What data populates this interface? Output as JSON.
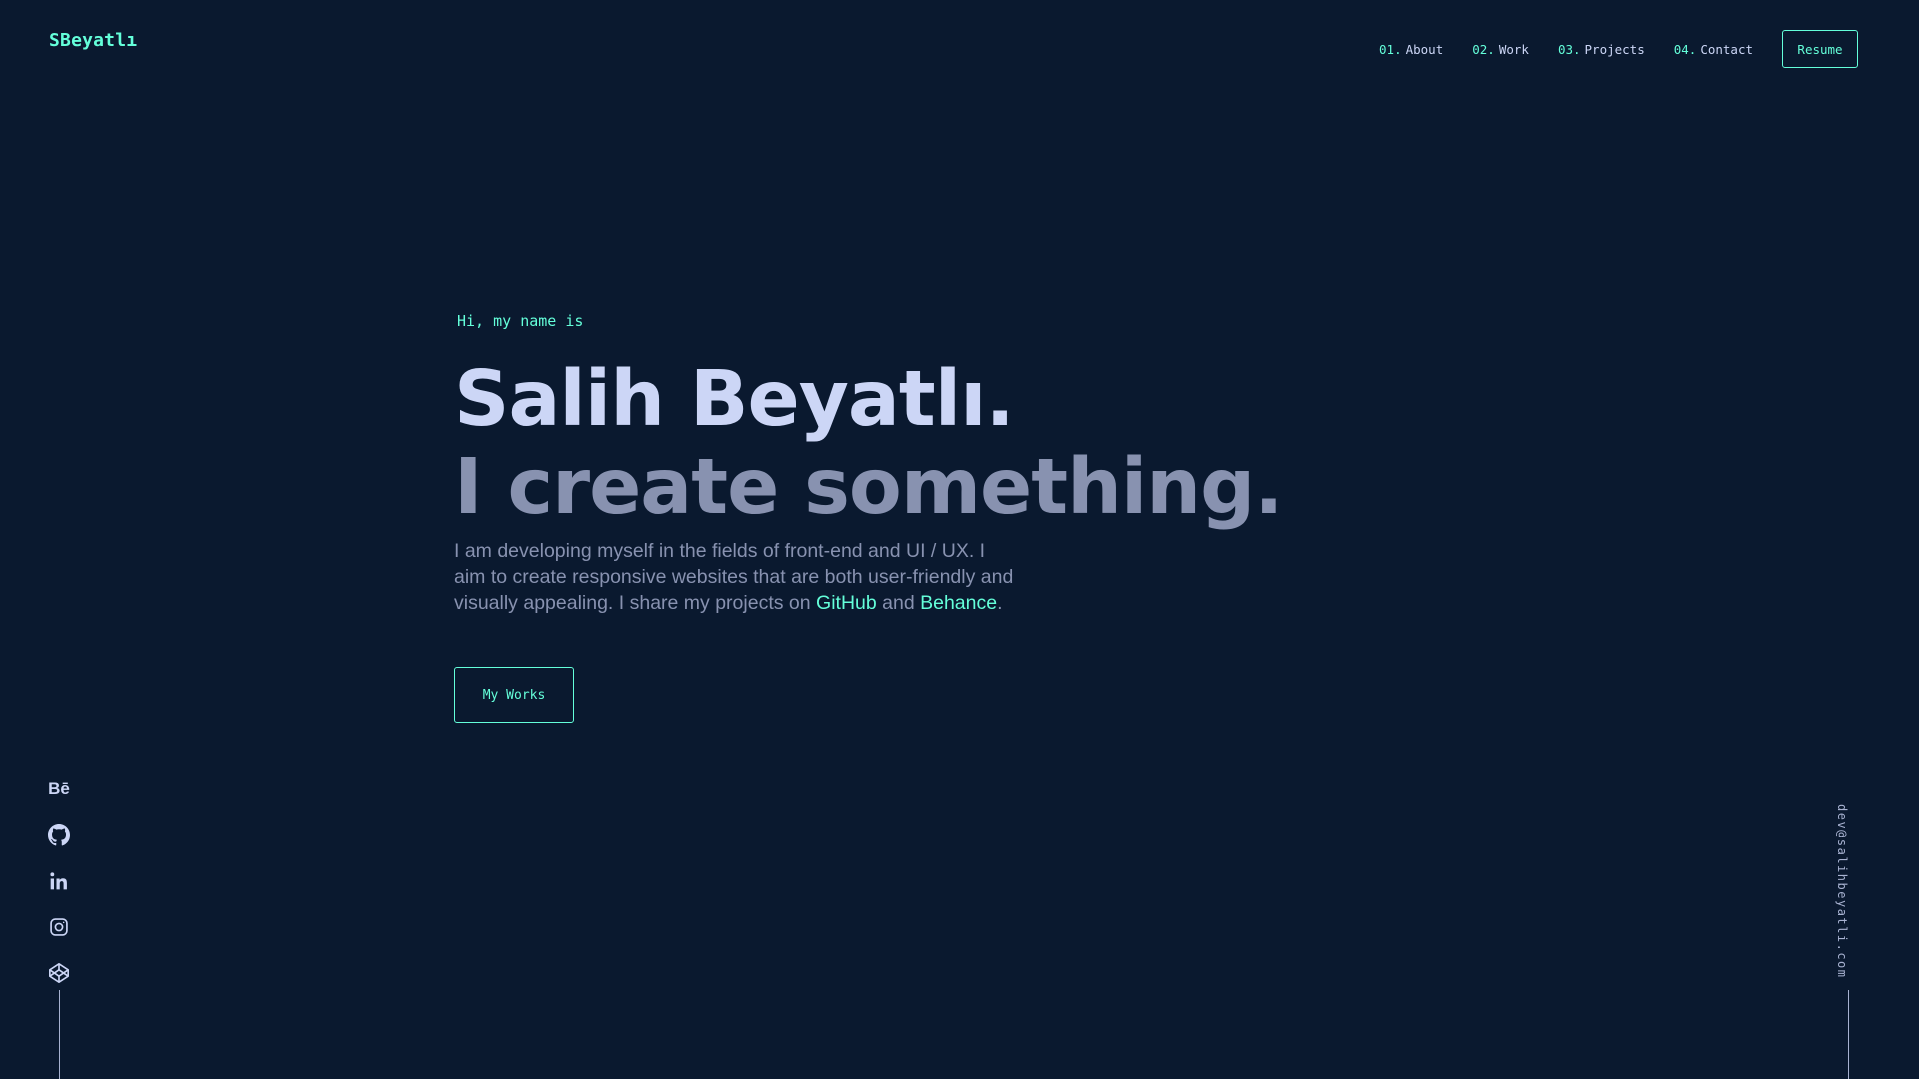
{
  "logo": "SBeyatlı",
  "nav": {
    "items": [
      {
        "num": "01.",
        "label": "About"
      },
      {
        "num": "02.",
        "label": "Work"
      },
      {
        "num": "03.",
        "label": "Projects"
      },
      {
        "num": "04.",
        "label": "Contact"
      }
    ],
    "resume_label": "Resume"
  },
  "hero": {
    "greeting": "Hi, my name is",
    "name": "Salih Beyatlı.",
    "tagline": "I create something.",
    "description": {
      "part1": "I am developing myself in the fields of front-end and UI / UX. I aim to create responsive websites that are both user-friendly and visually appealing. I share my projects on ",
      "link1": "GitHub",
      "part2": " and ",
      "link2": "Behance",
      "part3": "."
    },
    "cta_label": "My Works"
  },
  "social": {
    "behance_text": "Bē",
    "icons": [
      "behance-icon",
      "github-icon",
      "linkedin-icon",
      "instagram-icon",
      "codepen-icon"
    ]
  },
  "email": "dev@salihbeyatli.com",
  "colors": {
    "background": "#0a192f",
    "accent": "#64ffda",
    "heading": "#ccd6f6",
    "text": "#8892b0",
    "line": "#a8b2d1"
  }
}
